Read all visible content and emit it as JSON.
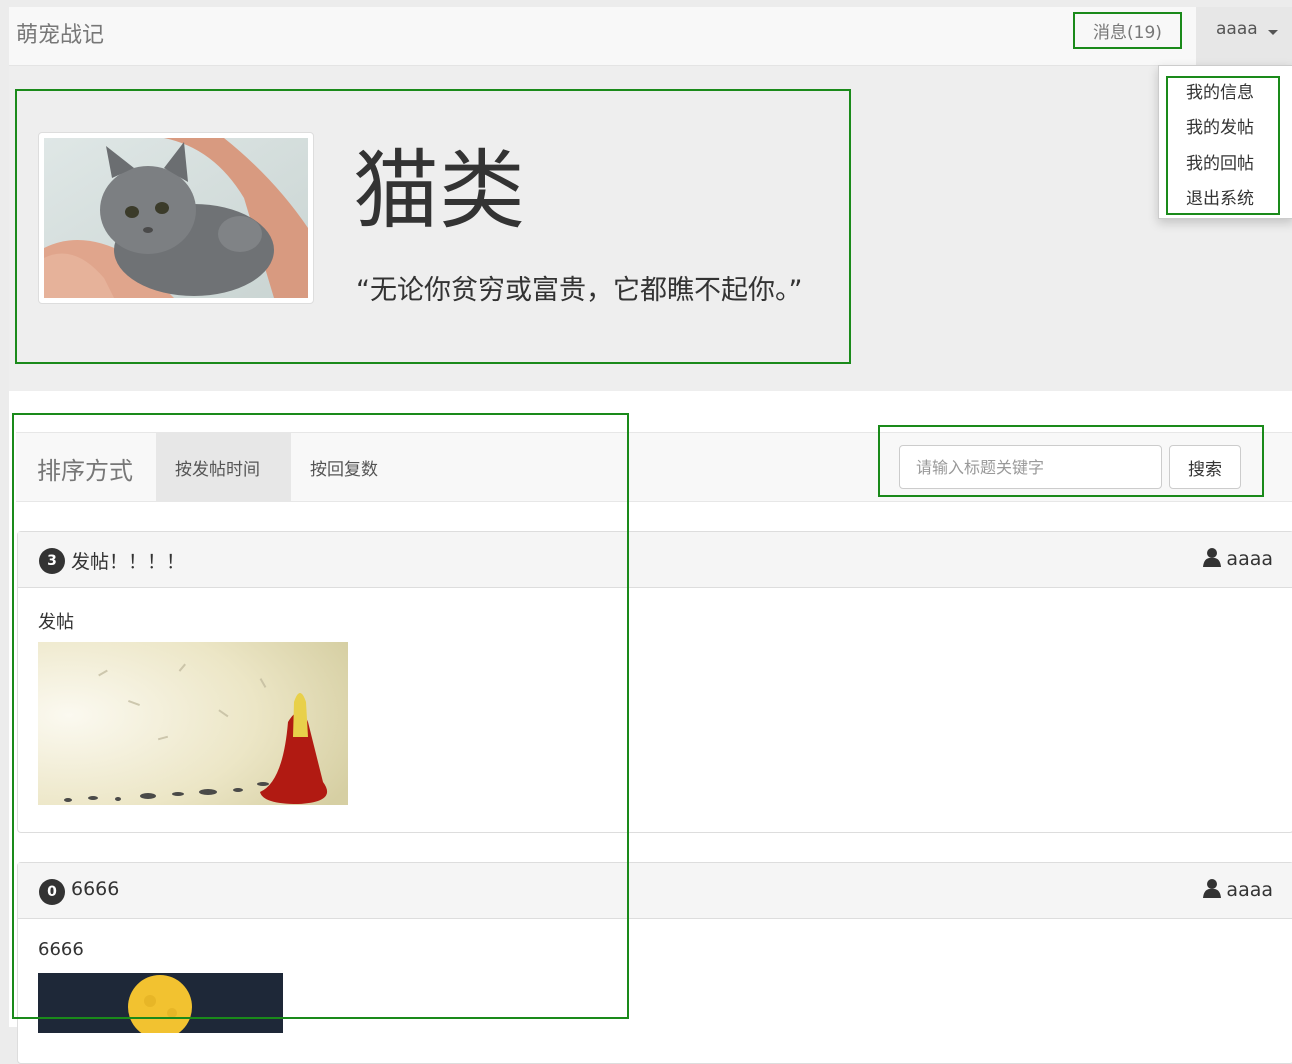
{
  "navbar": {
    "brand": "萌宠战记",
    "messages_label": "消息(19)",
    "username": "aaaa"
  },
  "user_menu": {
    "items": [
      "我的信息",
      "我的发帖",
      "我的回帖",
      "退出系统"
    ]
  },
  "jumbotron": {
    "title": "猫类",
    "quote": "“无论你贫穷或富贵，它都瞧不起你。”"
  },
  "sort": {
    "label": "排序方式",
    "tabs": [
      "按发帖时间",
      "按回复数"
    ],
    "active_tab": "按发帖时间"
  },
  "search": {
    "placeholder": "请输入标题关键字",
    "button_label": "搜索"
  },
  "posts": [
    {
      "reply_count": "3",
      "title": "发帖！！！！",
      "author": "aaaa",
      "body": "发帖"
    },
    {
      "reply_count": "0",
      "title": "6666",
      "author": "aaaa",
      "body": "6666"
    }
  ],
  "colors": {
    "annotation": "#1a8a1a",
    "navbar_bg": "#f8f8f8",
    "jumbotron_bg": "#eeeeee",
    "badge_bg": "#333333"
  }
}
